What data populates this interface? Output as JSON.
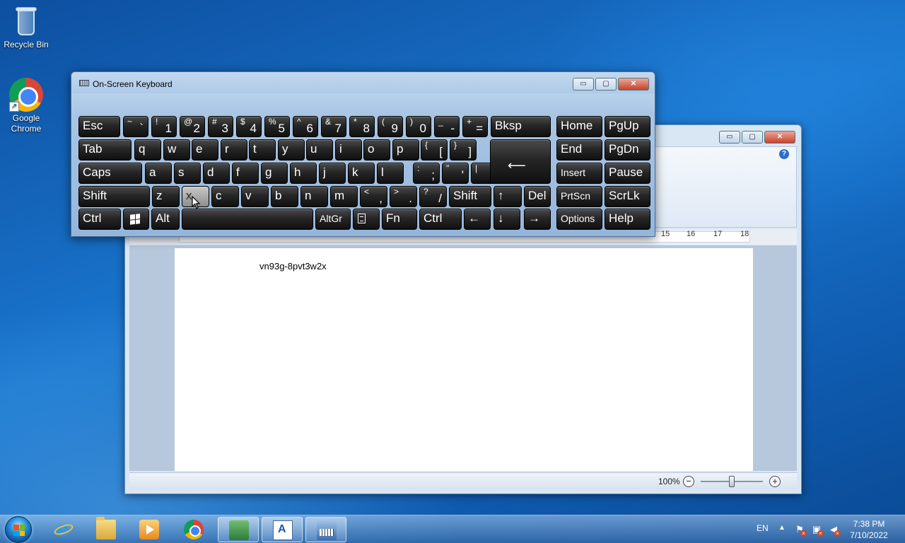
{
  "desktop": {
    "icons": [
      {
        "label": "Recycle Bin",
        "icon": "recycle-bin-icon"
      },
      {
        "label": "Google Chrome",
        "icon": "chrome-icon"
      }
    ]
  },
  "osk": {
    "title": "On-Screen Keyboard",
    "rows": [
      [
        {
          "main": "Esc"
        },
        {
          "shift": "~",
          "base": "`"
        },
        {
          "shift": "!",
          "base": "1"
        },
        {
          "shift": "@",
          "base": "2"
        },
        {
          "shift": "#",
          "base": "3"
        },
        {
          "shift": "$",
          "base": "4"
        },
        {
          "shift": "%",
          "base": "5"
        },
        {
          "shift": "^",
          "base": "6"
        },
        {
          "shift": "&",
          "base": "7"
        },
        {
          "shift": "*",
          "base": "8"
        },
        {
          "shift": "(",
          "base": "9"
        },
        {
          "shift": ")",
          "base": "0"
        },
        {
          "shift": "_",
          "base": "-"
        },
        {
          "shift": "+",
          "base": "="
        },
        {
          "main": "Bksp"
        },
        {
          "main": "Home"
        },
        {
          "main": "PgUp"
        }
      ],
      [
        {
          "main": "Tab"
        },
        {
          "main": "q"
        },
        {
          "main": "w"
        },
        {
          "main": "e"
        },
        {
          "main": "r"
        },
        {
          "main": "t"
        },
        {
          "main": "y"
        },
        {
          "main": "u"
        },
        {
          "main": "i"
        },
        {
          "main": "o"
        },
        {
          "main": "p"
        },
        {
          "shift": "{",
          "base": "["
        },
        {
          "shift": "}",
          "base": "]"
        },
        {
          "main": "End"
        },
        {
          "main": "PgDn"
        }
      ],
      [
        {
          "main": "Caps"
        },
        {
          "main": "a"
        },
        {
          "main": "s"
        },
        {
          "main": "d"
        },
        {
          "main": "f"
        },
        {
          "main": "g"
        },
        {
          "main": "h"
        },
        {
          "main": "j"
        },
        {
          "main": "k"
        },
        {
          "main": "l"
        },
        {
          "shift": ":",
          "base": ";"
        },
        {
          "shift": "\"",
          "base": "'"
        },
        {
          "shift": "|",
          "base": "\\"
        },
        {
          "main": "Insert"
        },
        {
          "main": "Pause"
        }
      ],
      [
        {
          "main": "Shift"
        },
        {
          "main": "z"
        },
        {
          "main": "x"
        },
        {
          "main": "c"
        },
        {
          "main": "v"
        },
        {
          "main": "b"
        },
        {
          "main": "n"
        },
        {
          "main": "m"
        },
        {
          "shift": "<",
          "base": ","
        },
        {
          "shift": ">",
          "base": "."
        },
        {
          "shift": "?",
          "base": "/"
        },
        {
          "main": "Shift"
        },
        {
          "main": "↑"
        },
        {
          "main": "Del"
        },
        {
          "main": "PrtScn"
        },
        {
          "main": "ScrLk"
        }
      ],
      [
        {
          "main": "Ctrl"
        },
        {
          "main": "",
          "icon": "windows-logo-icon"
        },
        {
          "main": "Alt"
        },
        {
          "main": ""
        },
        {
          "main": "AltGr"
        },
        {
          "main": "",
          "icon": "menu-key-icon"
        },
        {
          "main": "Fn"
        },
        {
          "main": "Ctrl"
        },
        {
          "main": "←"
        },
        {
          "main": "↓"
        },
        {
          "main": "→"
        },
        {
          "main": "Options"
        },
        {
          "main": "Help"
        }
      ]
    ],
    "enter_symbol": "⟵",
    "pressed_key": "x"
  },
  "wordpad": {
    "ruler": [
      "15",
      "16",
      "17",
      "18"
    ],
    "document_text": "vn93g-8pvt3w2x",
    "zoom": "100%",
    "zoom_minus": "−",
    "zoom_plus": "+",
    "help": "?"
  },
  "window_controls": {
    "minimize": "▭",
    "maximize": "▢",
    "close": "✕"
  },
  "taskbar": {
    "apps": [
      "internet-explorer-icon",
      "file-explorer-icon",
      "media-player-icon",
      "chrome-icon",
      "app-icon",
      "wordpad-icon",
      "on-screen-keyboard-icon"
    ],
    "language": "EN",
    "show_hidden": "▲",
    "time": "7:38 PM",
    "date": "7/10/2022"
  }
}
